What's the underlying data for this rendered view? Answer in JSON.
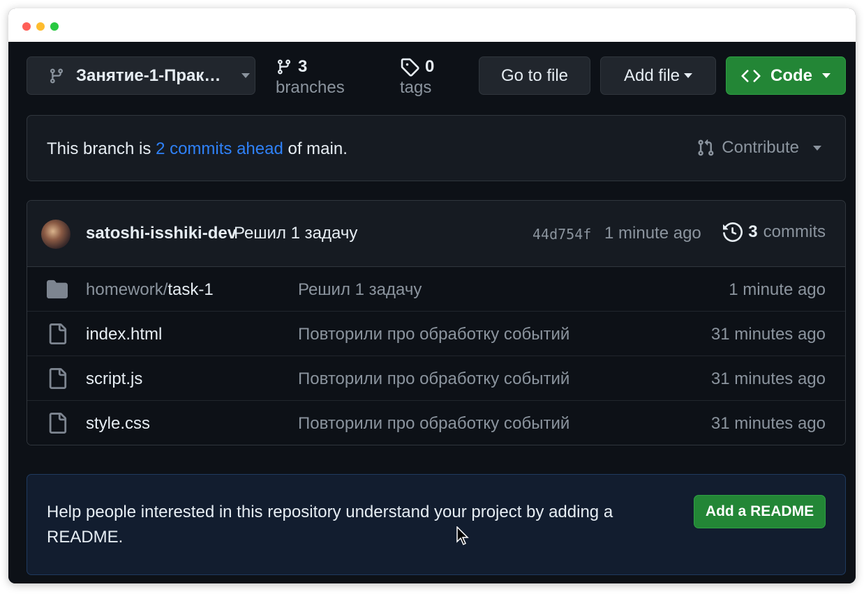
{
  "toolbar": {
    "branch_name": "Занятие-1-Прак…",
    "branches_count": "3",
    "branches_label": "branches",
    "tags_count": "0",
    "tags_label": "tags",
    "go_to_file": "Go to file",
    "add_file": "Add file",
    "code": "Code"
  },
  "ahead": {
    "prefix": "This branch is ",
    "link": "2 commits ahead",
    "suffix": " of main.",
    "contribute": "Contribute"
  },
  "commit": {
    "author": "satoshi-isshiki-dev",
    "message": "Решил 1 задачу",
    "sha": "44d754f",
    "time": "1 minute ago",
    "count": "3",
    "count_label": "commits"
  },
  "files": [
    {
      "type": "folder-icon",
      "dir": "homework/",
      "name": "task-1",
      "message": "Решил 1 задачу",
      "time": "1 minute ago"
    },
    {
      "type": "file-icon",
      "dir": "",
      "name": "index.html",
      "message": "Повторили про обработку событий",
      "time": "31 minutes ago"
    },
    {
      "type": "file-icon",
      "dir": "",
      "name": "script.js",
      "message": "Повторили про обработку событий",
      "time": "31 minutes ago"
    },
    {
      "type": "file-icon",
      "dir": "",
      "name": "style.css",
      "message": "Повторили про обработку событий",
      "time": "31 minutes ago"
    }
  ],
  "readme": {
    "text": "Help people interested in this repository understand your project by adding a README.",
    "button": "Add a README"
  },
  "colors": {
    "background": "#0d1117",
    "accent_green": "#238636",
    "link_blue": "#2f81f7",
    "muted": "#8b949e"
  }
}
